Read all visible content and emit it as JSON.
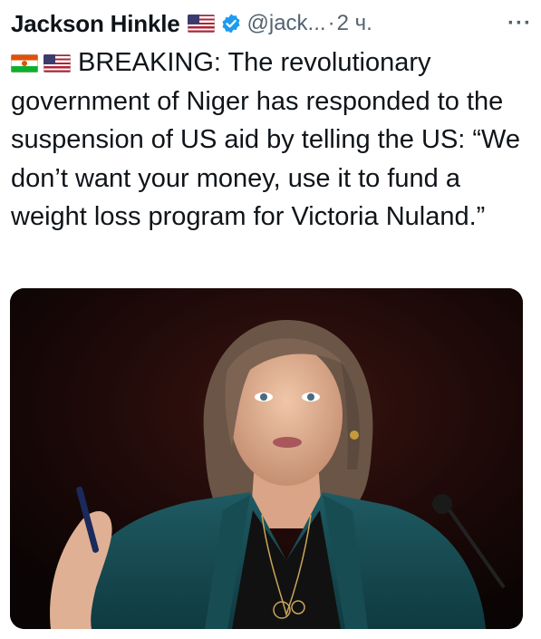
{
  "tweet": {
    "author_name": "Jackson Hinkle",
    "handle": "@jack...",
    "separator": "·",
    "time": "2 ч.",
    "more_label": "···",
    "text": "BREAKING: The revolutionary government of Niger has responded to the suspension of US aid by telling the US: “We don’t want your money, use it to fund a weight loss program for Victoria Nuland.”"
  },
  "icons": {
    "flag_us": "us-flag-icon",
    "flag_niger": "niger-flag-icon",
    "verified": "verified-badge-icon",
    "more": "more-options-icon"
  },
  "colors": {
    "text": "#0f1419",
    "secondary": "#536471",
    "verified_blue": "#1d9bf0"
  }
}
